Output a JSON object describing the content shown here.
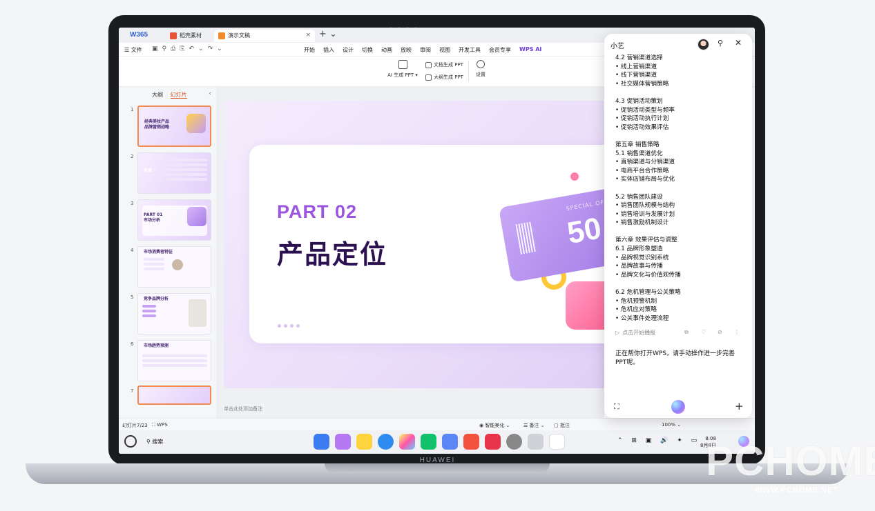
{
  "device": {
    "brand": "HUAWEI"
  },
  "window": {
    "logo": "W365",
    "tabs": [
      {
        "label": "稻壳素材"
      },
      {
        "label": "演示文稿",
        "close": "×"
      }
    ],
    "new_tab": "+ ⌄"
  },
  "menu": {
    "file": "☰ 文件",
    "quick_icons": "▣⚲⎙⎘↶⌄↷⌄",
    "tabs": [
      "开始",
      "插入",
      "设计",
      "切换",
      "动画",
      "放映",
      "审阅",
      "视图",
      "开发工具",
      "会员专享"
    ],
    "wps_ai": "WPS AI"
  },
  "ribbon": {
    "ai_ppt": "AI 生成 PPT ▾",
    "doc_ppt": "文档生成 PPT",
    "outline_ppt": "大纲生成 PPT",
    "settings": "设置"
  },
  "thumbnails": {
    "tab_outline": "大纲",
    "tab_slides": "幻灯片",
    "collapse": "‹",
    "items": [
      {
        "num": "1",
        "text": "经典美妆产品\n品牌营销战略"
      },
      {
        "num": "2",
        "text": "目录"
      },
      {
        "num": "3",
        "text": "PART 01\n市场分析"
      },
      {
        "num": "4",
        "text": "市场消费者特征"
      },
      {
        "num": "5",
        "text": "竞争品牌分析"
      },
      {
        "num": "6",
        "text": "市场趋势预测"
      },
      {
        "num": "7",
        "text": ""
      }
    ],
    "add": "+"
  },
  "slide": {
    "part": "PART 02",
    "title": "产品定位",
    "ticket_number": "50",
    "ticket_special": "SPECIAL OF"
  },
  "notes_placeholder": "单击此处添加备注",
  "status": {
    "slide_count": "幻灯片7/23",
    "theme": "⛶ WPS",
    "beautify": "◉ 智能美化 ⌄",
    "notes": "☰ 备注 ⌄",
    "comments": "▢ 批注",
    "zoom": "100% ⌄"
  },
  "taskbar": {
    "search": "⚲ 搜索",
    "tray": "⌃ ⊞ ▣ 🔊 ✦ ▭",
    "time": "8:08",
    "date": "8月8日"
  },
  "assistant": {
    "title": "小艺",
    "pin": "⚲",
    "close": "✕",
    "sections": [
      [
        "4.2 营销渠道选择",
        "• 线上营销渠道",
        "• 线下营销渠道",
        "• 社交媒体营销策略"
      ],
      [
        "4.3 促销活动策划",
        "• 促销活动类型与频率",
        "• 促销活动执行计划",
        "• 促销活动效果评估"
      ],
      [
        "第五章 销售策略",
        "5.1 销售渠道优化",
        "• 直销渠道与分销渠道",
        "• 电商平台合作策略",
        "• 实体店铺布局与优化"
      ],
      [
        "5.2 销售团队建设",
        "• 销售团队规模与结构",
        "• 销售培训与发展计划",
        "• 销售激励机制设计"
      ],
      [
        "第六章 效果评估与调整",
        "6.1 品牌形象塑造",
        "• 品牌视觉识别系统",
        "• 品牌故事与传播",
        "• 品牌文化与价值观传播"
      ],
      [
        "6.2 危机管理与公关策略",
        "• 危机预警机制",
        "• 危机应对策略",
        "• 公关事件处理流程"
      ]
    ],
    "play_label": "点击开始播报",
    "reply": "正在帮你打开WPS，请手动操作进一步完善PPT呢。",
    "crop": "⛶",
    "plus": "+"
  },
  "watermark": {
    "brand": "PCHOME",
    "url": "WWW.PCHOME.NET"
  },
  "colors": {
    "accent_purple": "#9b56e0",
    "title_dark": "#2c1150",
    "wps_orange": "#d9541f"
  }
}
